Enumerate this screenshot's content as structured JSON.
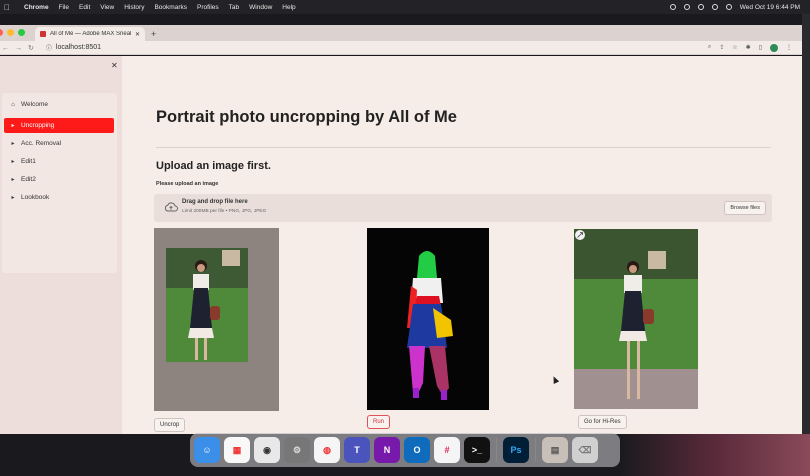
{
  "menubar": {
    "app": "Chrome",
    "items": [
      "File",
      "Edit",
      "View",
      "History",
      "Bookmarks",
      "Profiles",
      "Tab",
      "Window",
      "Help"
    ],
    "clock": "Wed Oct 19  6:44 PM"
  },
  "tab": {
    "title": "All of Me — Adobe MAX Sneak"
  },
  "address": {
    "url": "localhost:8501"
  },
  "sidebar": {
    "items": [
      {
        "label": "Welcome",
        "icon": "home-icon"
      },
      {
        "label": "Uncropping",
        "icon": "chevron-right-icon",
        "active": true
      },
      {
        "label": "Acc. Removal",
        "icon": "chevron-right-icon"
      },
      {
        "label": "Edit1",
        "icon": "chevron-right-icon"
      },
      {
        "label": "Edit2",
        "icon": "chevron-right-icon"
      },
      {
        "label": "Lookbook",
        "icon": "chevron-right-icon"
      }
    ]
  },
  "main": {
    "title": "Portrait photo uncropping by All of Me",
    "subtitle": "Upload an image first.",
    "upload_hint": "Please upload an image",
    "dropzone": {
      "title": "Drag and drop file here",
      "limit": "Limit 200MB per file • PNG, JPG, JPEG",
      "browse": "Browse files"
    },
    "buttons": {
      "uncrop": "Uncrop",
      "run": "Run",
      "hires": "Go for Hi-Res"
    }
  },
  "colors": {
    "accent": "#ff1a1a",
    "page_bg": "#f6ece8",
    "sidebar_bg": "#eddedb"
  }
}
